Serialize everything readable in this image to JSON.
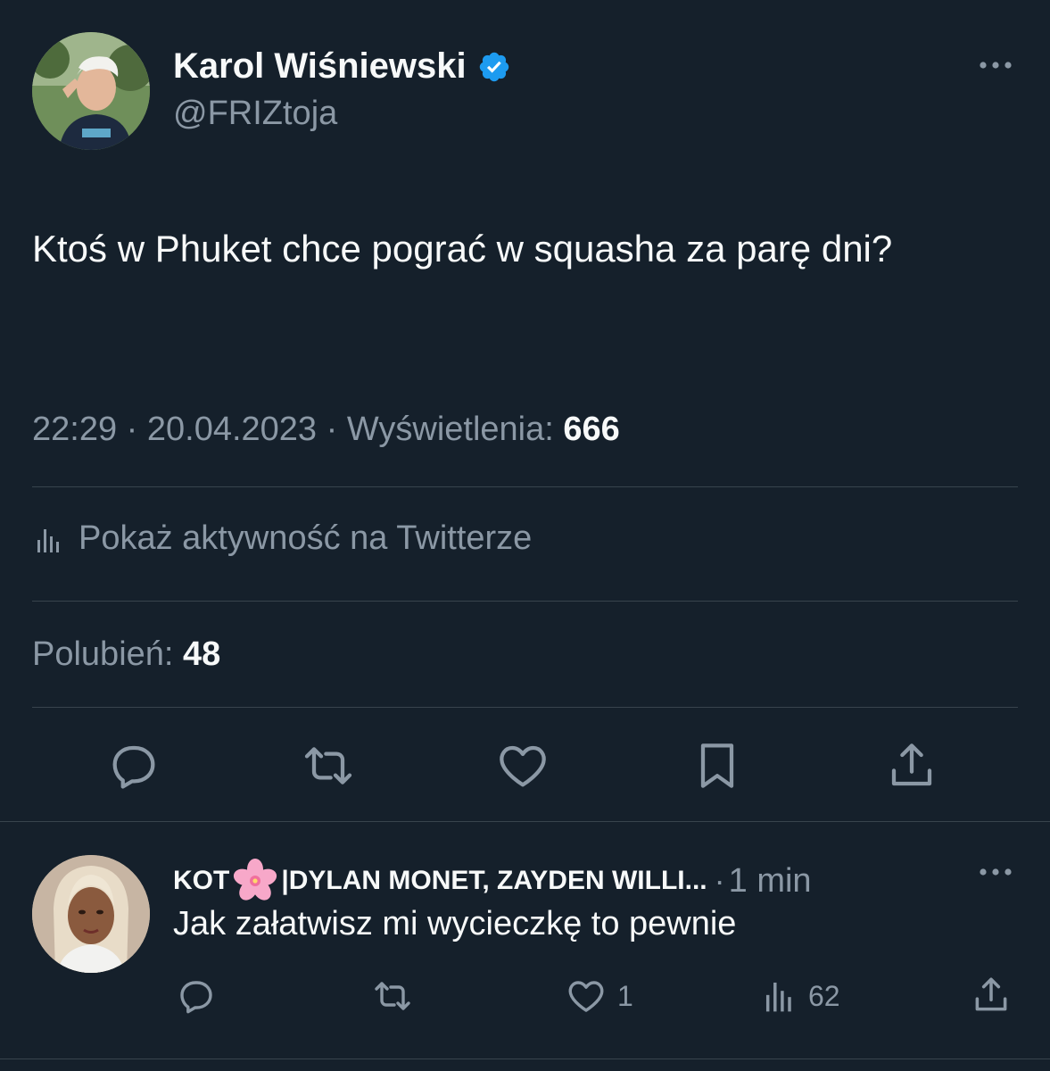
{
  "tweet": {
    "author_name": "Karol Wiśniewski",
    "author_handle": "@FRIZtoja",
    "text": "Ktoś w Phuket chce pograć w squasha za parę dni?",
    "time": "22:29",
    "date": "20.04.2023",
    "views_label": "Wyświetlenia:",
    "views_count": "666",
    "activity_label": "Pokaż aktywność na Twitterze",
    "likes_label": "Polubień:",
    "likes_count": "48"
  },
  "reply": {
    "author_name_prefix": "KOT",
    "author_name_suffix": "|DYLAN MONET, ZAYDEN WILLI...",
    "time": "1 min",
    "text": "Jak załatwisz mi wycieczkę to pewnie",
    "like_count": "1",
    "view_count": "62"
  },
  "colors": {
    "background": "#15202b",
    "text_primary": "#f7f9f9",
    "text_secondary": "#8b98a5",
    "divider": "#38444d",
    "verified": "#1d9bf0"
  },
  "icons": {
    "verified": "verified-badge-icon",
    "more": "more-dots-icon",
    "reply": "reply-bubble-icon",
    "retweet": "retweet-icon",
    "like": "heart-icon",
    "bookmark": "bookmark-icon",
    "share": "share-icon",
    "views": "analytics-bars-icon",
    "flower": "cherry-blossom-icon"
  }
}
